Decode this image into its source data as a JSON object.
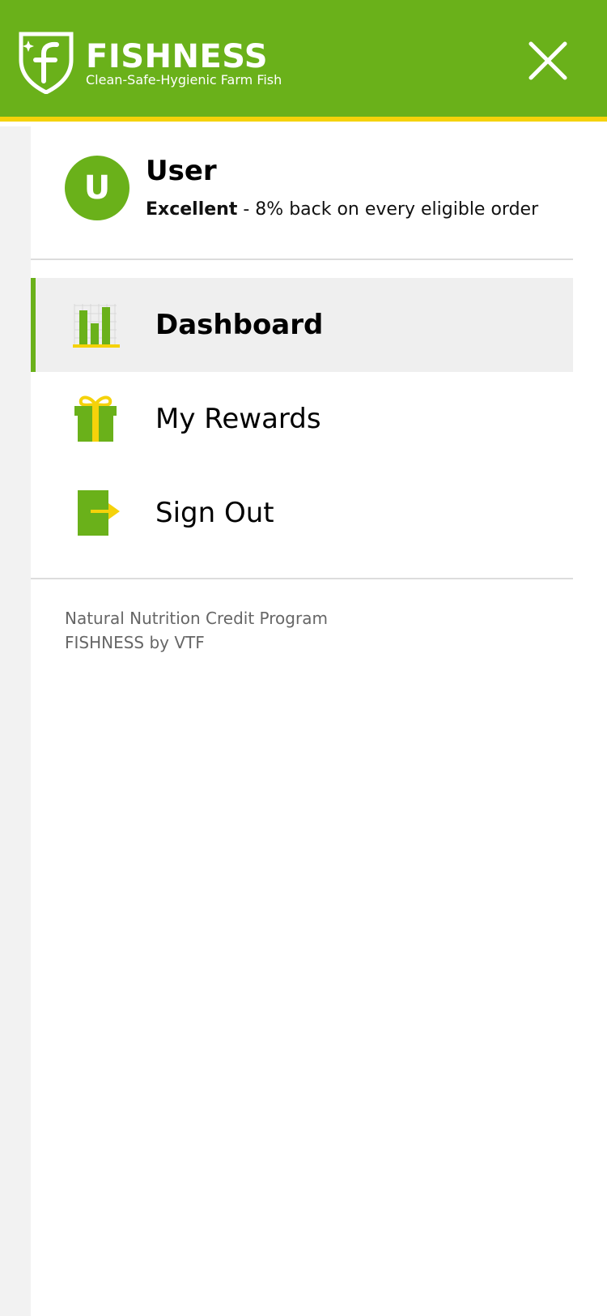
{
  "header": {
    "brand_name": "FISHNESS",
    "tagline": "Clean-Safe-Hygienic Farm Fish",
    "close_icon": "close-icon"
  },
  "colors": {
    "brand_green": "#6ab11a",
    "accent_yellow": "#f5d20a",
    "active_item_bg": "#efefef"
  },
  "user": {
    "avatar_initial": "U",
    "name": "User",
    "tier": "Excellent",
    "tier_description": " - 8% back on every eligible order"
  },
  "menu": {
    "items": [
      {
        "label": "Dashboard",
        "icon": "bar-chart-icon",
        "active": true
      },
      {
        "label": "My Rewards",
        "icon": "gift-icon",
        "active": false
      },
      {
        "label": "Sign Out",
        "icon": "sign-out-icon",
        "active": false
      }
    ]
  },
  "footer": {
    "line1": "Natural Nutrition Credit Program",
    "line2": "FISHNESS by VTF"
  }
}
